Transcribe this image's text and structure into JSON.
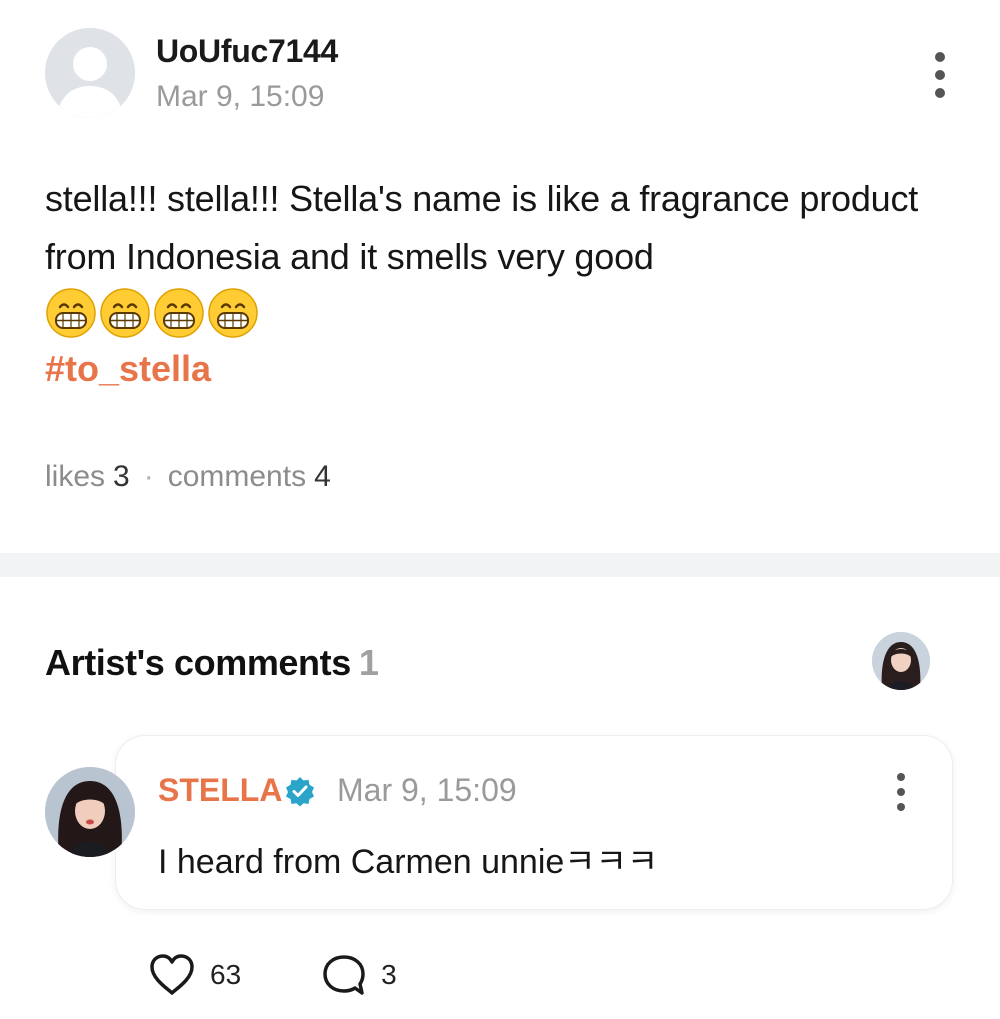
{
  "post": {
    "username": "UoUfuc7144",
    "time": "Mar 9, 15:09",
    "body": "stella!!! stella!!! Stella's name is like a fragrance product from Indonesia and it smells very good",
    "emoji_icons": [
      "grinning-face-icon",
      "grinning-face-icon",
      "grinning-face-icon",
      "grinning-face-icon"
    ],
    "hashtag": "#to_stella",
    "likes_label": "likes",
    "likes_count": "3",
    "separator": "·",
    "comments_label": "comments",
    "comments_count": "4"
  },
  "artist_comments": {
    "title": "Artist's comments",
    "count": "1",
    "comment": {
      "author": "STELLA",
      "verified_icon": "verified-badge-icon",
      "time": "Mar 9, 15:09",
      "text": "I heard from Carmen unnieㅋㅋㅋ",
      "likes": "63",
      "replies": "3"
    }
  },
  "colors": {
    "accent": "#e8744a",
    "verified": "#2aa4c9",
    "muted_text": "#9a9a9a",
    "divider": "#f2f3f5"
  }
}
